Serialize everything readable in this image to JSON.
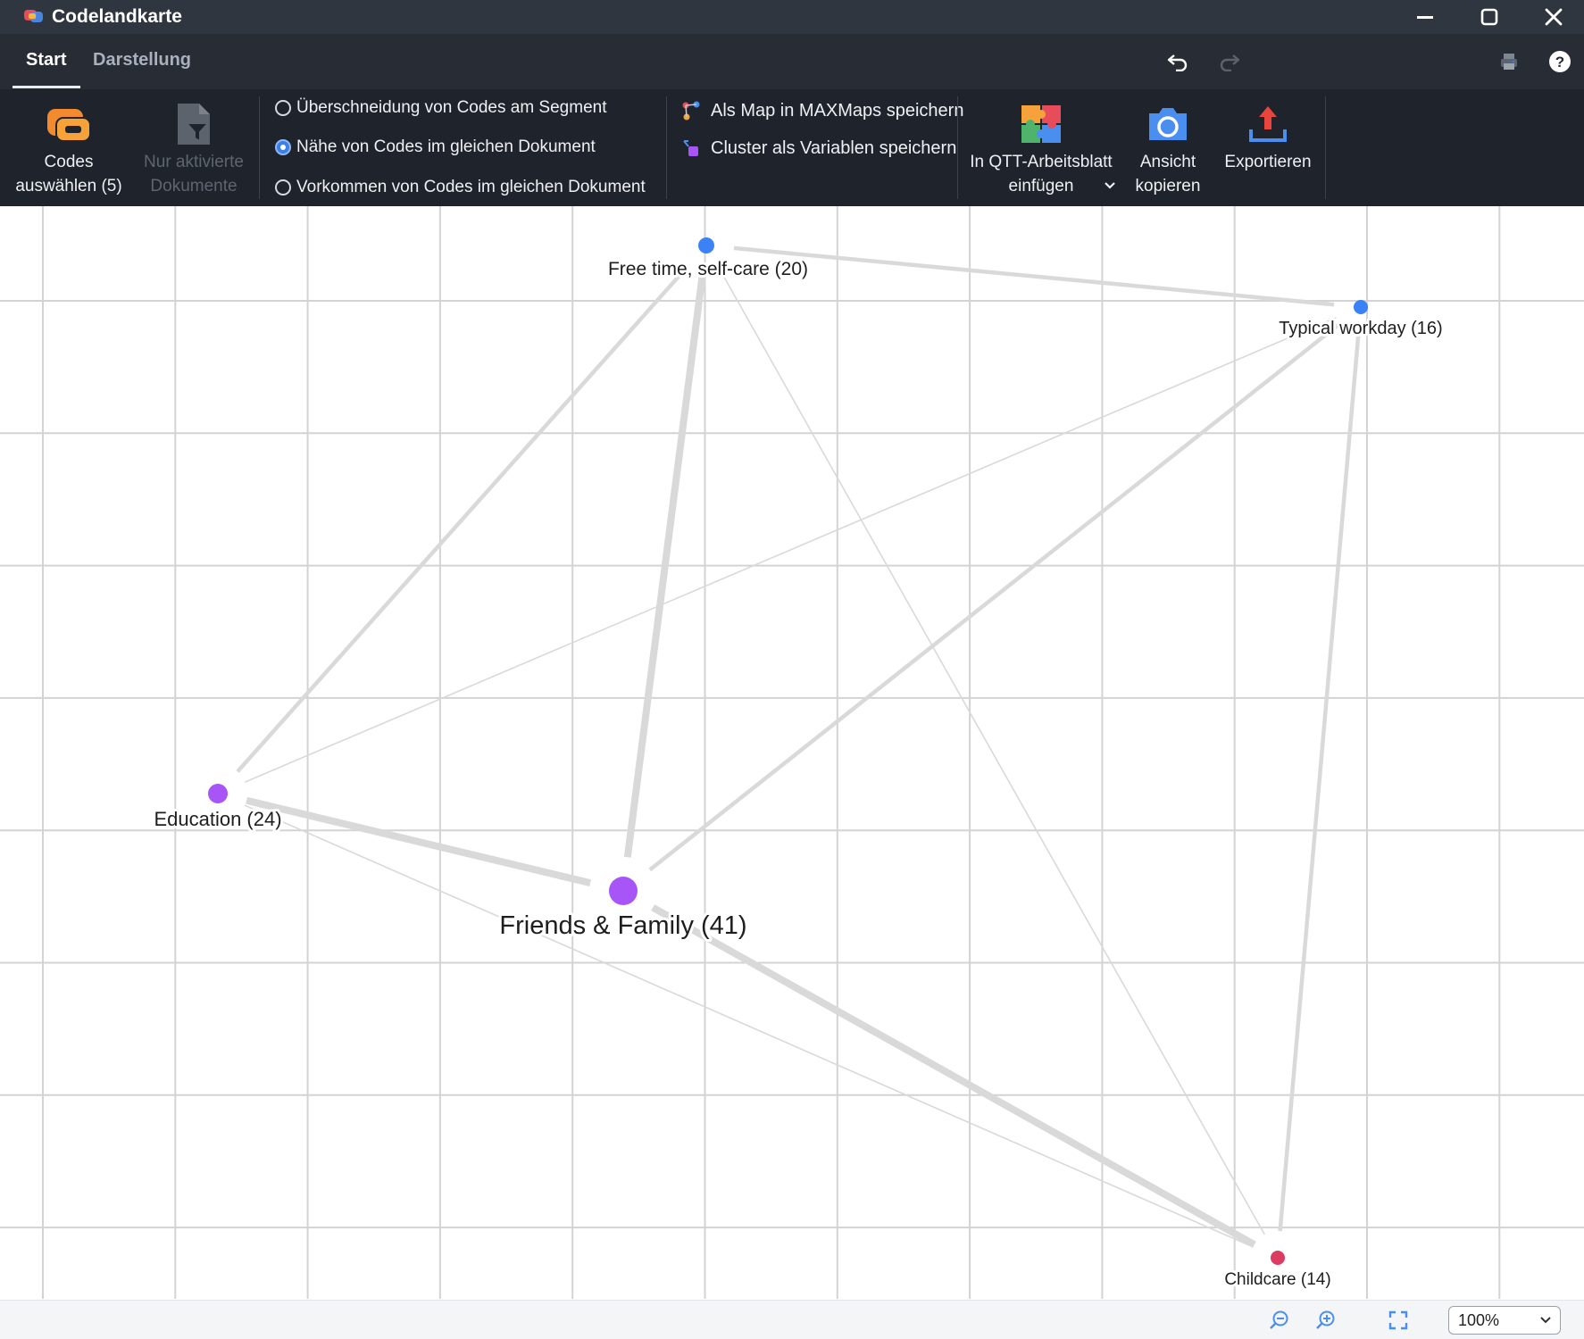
{
  "window": {
    "title": "Codelandkarte",
    "icon": "codemap-app-icon",
    "controls": [
      "minimize-icon",
      "maximize-icon",
      "close-icon"
    ]
  },
  "tabs": [
    {
      "label": "Start",
      "active": true
    },
    {
      "label": "Darstellung",
      "active": false
    }
  ],
  "toolbar_icons": [
    "undo-icon",
    "redo-icon",
    "print-icon",
    "help-icon"
  ],
  "ribbon": {
    "codes_button": {
      "line1": "Codes",
      "line2": "auswählen (5)"
    },
    "docs_button": {
      "line1": "Nur aktivierte",
      "line2": "Dokumente",
      "disabled": true
    },
    "radio_options": [
      {
        "label": "Überschneidung von Codes am Segment",
        "checked": false
      },
      {
        "label": "Nähe von Codes im gleichen Dokument",
        "checked": true
      },
      {
        "label": "Vorkommen von Codes im gleichen Dokument",
        "checked": false
      }
    ],
    "actions": [
      {
        "label": "Als Map in MAXMaps speichern",
        "icon": "maxmaps-icon"
      },
      {
        "label": "Cluster als Variablen speichern",
        "icon": "cluster-variable-icon"
      }
    ],
    "qtt_button": {
      "line1": "In QTT-Arbeitsblatt",
      "line2": "einfügen"
    },
    "copy_view_button": {
      "line1": "Ansicht",
      "line2": "kopieren"
    },
    "export_button": {
      "line1": "Exportieren"
    }
  },
  "map": {
    "nodes": [
      {
        "id": "free_time",
        "label": "Free time, self-care (20)",
        "color": "#3b82f6"
      },
      {
        "id": "typical_workday",
        "label": "Typical workday (16)",
        "color": "#3b82f6"
      },
      {
        "id": "education",
        "label": "Education (24)",
        "color": "#a855f7"
      },
      {
        "id": "friends_family",
        "label": "Friends & Family (41)",
        "color": "#a855f7"
      },
      {
        "id": "childcare",
        "label": "Childcare (14)",
        "color": "#dc3b62"
      }
    ],
    "edge_color": "#d9d9d9",
    "edges": [
      {
        "from": "free_time",
        "to": "typical_workday",
        "weight": "medium"
      },
      {
        "from": "free_time",
        "to": "education",
        "weight": "medium"
      },
      {
        "from": "free_time",
        "to": "friends_family",
        "weight": "strong"
      },
      {
        "from": "free_time",
        "to": "childcare",
        "weight": "weak"
      },
      {
        "from": "typical_workday",
        "to": "education",
        "weight": "weak"
      },
      {
        "from": "typical_workday",
        "to": "friends_family",
        "weight": "medium"
      },
      {
        "from": "typical_workday",
        "to": "childcare",
        "weight": "medium"
      },
      {
        "from": "education",
        "to": "friends_family",
        "weight": "strong"
      },
      {
        "from": "education",
        "to": "childcare",
        "weight": "weak"
      },
      {
        "from": "friends_family",
        "to": "childcare",
        "weight": "strong"
      }
    ]
  },
  "statusbar": {
    "icons": [
      "zoom-out-icon",
      "zoom-in-icon",
      "fit-to-screen-icon"
    ],
    "zoom": "100%"
  }
}
